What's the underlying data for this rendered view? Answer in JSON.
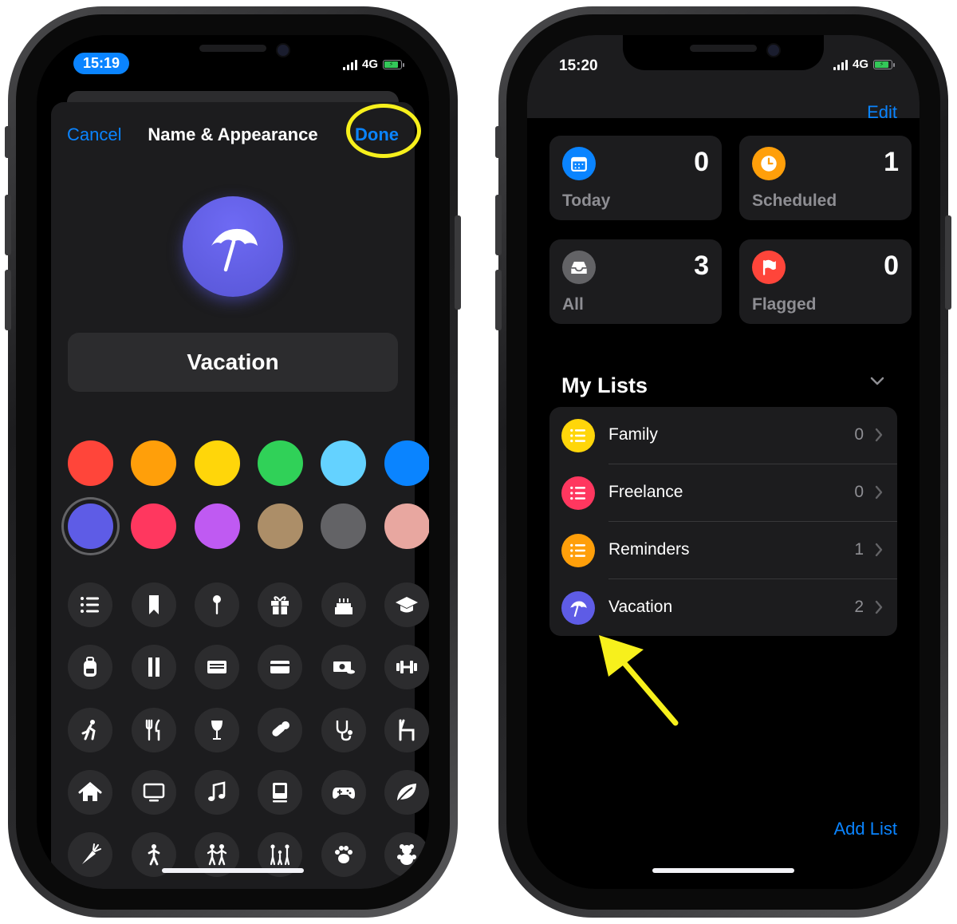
{
  "left_screen": {
    "status": {
      "time": "15:19",
      "network": "4G"
    },
    "nav": {
      "cancel": "Cancel",
      "title": "Name & Appearance",
      "done": "Done"
    },
    "list_icon": "umbrella-icon",
    "list_color": "#5e5ce6",
    "name_value": "Vacation",
    "colors": [
      "#ff453a",
      "#ff9f0a",
      "#ffd60a",
      "#30d158",
      "#64d2ff",
      "#0a84ff",
      "#5e5ce6",
      "#ff375f",
      "#bf5af2",
      "#ac8e68",
      "#636366",
      "#e8a7a0"
    ],
    "selected_color_index": 6,
    "glyphs": [
      "list-icon",
      "bookmark-icon",
      "pin-icon",
      "gift-icon",
      "birthday-cake-icon",
      "graduation-cap-icon",
      "backpack-icon",
      "pencil-ruler-icon",
      "document-icon",
      "credit-card-icon",
      "money-icon",
      "dumbbell-icon",
      "runner-icon",
      "fork-knife-icon",
      "wine-glass-icon",
      "pills-icon",
      "stethoscope-icon",
      "chair-icon",
      "house-icon",
      "tv-icon",
      "music-note-icon",
      "computer-icon",
      "game-controller-icon",
      "leaf-icon",
      "carrot-icon",
      "person-icon",
      "two-people-icon",
      "family-icon",
      "paw-icon",
      "teddy-bear-icon"
    ]
  },
  "right_screen": {
    "status": {
      "time": "15:20",
      "network": "4G"
    },
    "edit": "Edit",
    "cards": [
      {
        "label": "Today",
        "count": "0",
        "icon": "calendar-icon",
        "color": "#0a84ff"
      },
      {
        "label": "Scheduled",
        "count": "1",
        "icon": "clock-icon",
        "color": "#ff9f0a"
      },
      {
        "label": "All",
        "count": "3",
        "icon": "tray-icon",
        "color": "#636366"
      },
      {
        "label": "Flagged",
        "count": "0",
        "icon": "flag-icon",
        "color": "#ff453a"
      }
    ],
    "my_lists_title": "My Lists",
    "lists": [
      {
        "name": "Family",
        "count": "0",
        "icon": "list-icon",
        "color": "#ffd60a"
      },
      {
        "name": "Freelance",
        "count": "0",
        "icon": "list-icon",
        "color": "#ff375f"
      },
      {
        "name": "Reminders",
        "count": "1",
        "icon": "list-icon",
        "color": "#ff9f0a"
      },
      {
        "name": "Vacation",
        "count": "2",
        "icon": "umbrella-icon",
        "color": "#5e5ce6"
      }
    ],
    "add_list": "Add List"
  }
}
